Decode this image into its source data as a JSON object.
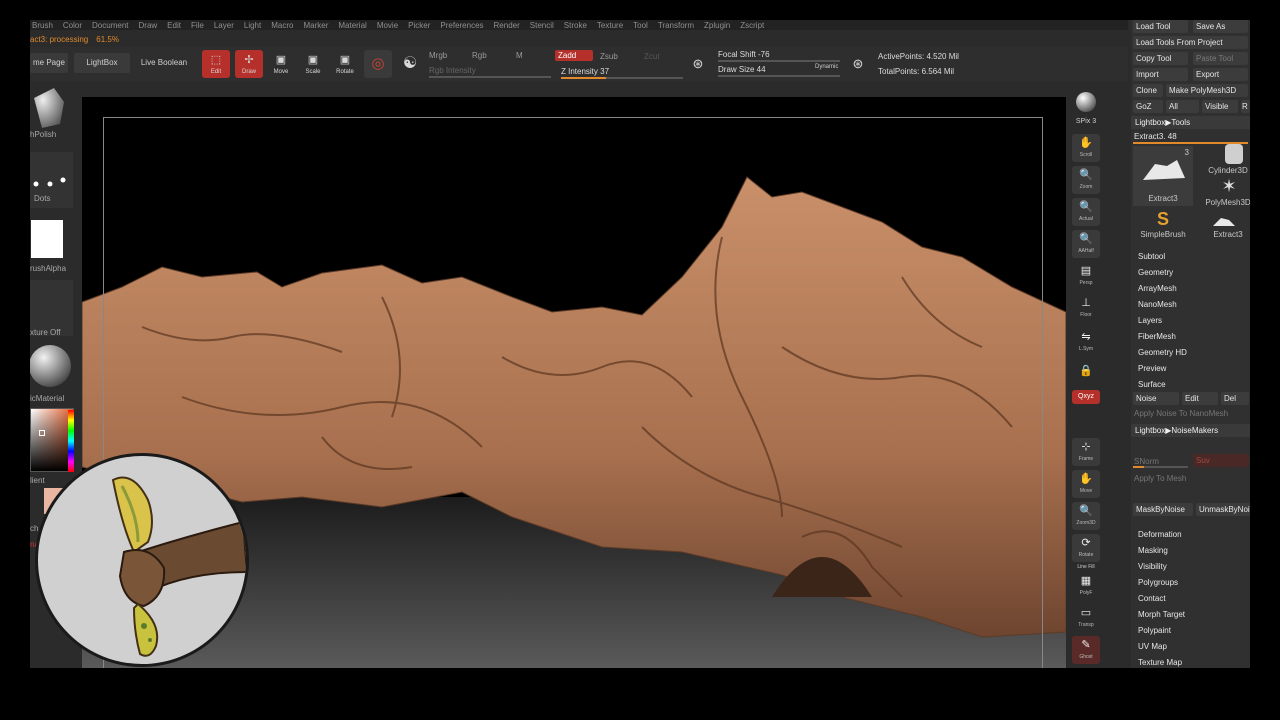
{
  "menubar": [
    "Brush",
    "Color",
    "Document",
    "Draw",
    "Edit",
    "File",
    "Layer",
    "Light",
    "Macro",
    "Marker",
    "Material",
    "Movie",
    "Picker",
    "Preferences",
    "Render",
    "Stencil",
    "Stroke",
    "Texture",
    "Tool",
    "Transform",
    "Zplugin",
    "Zscript"
  ],
  "status": {
    "task": "act3: processing",
    "percent": "61.5%"
  },
  "toolbar": {
    "home_page": "me Page",
    "lightbox": "LightBox",
    "live_boolean": "Live Boolean",
    "edit": "Edit",
    "draw": "Draw",
    "move": "Move",
    "scale": "Scale",
    "rotate": "Rotate",
    "mrgb": "Mrgb",
    "rgb": "Rgb",
    "m": "M",
    "rgb_intensity": "Rgb Intensity",
    "zadd": "Zadd",
    "zsub": "Zsub",
    "zcut": "Zcut",
    "z_intensity": "Z Intensity 37",
    "z_intensity_value": 37,
    "focal_shift": "Focal Shift -76",
    "draw_size": "Draw Size 44",
    "dynamic": "Dynamic",
    "active_points": "ActivePoints: 4.520 Mil",
    "total_points": "TotalPoints: 6.564 Mil"
  },
  "leftshelf": {
    "brush": "hPolish",
    "stroke": "Dots",
    "alpha": "rushAlpha",
    "texture": "xture Off",
    "material": "icMaterial",
    "gradient": "lient",
    "switch_color": "ch Color",
    "alternate": "nate"
  },
  "rightstrip": {
    "bpr": "BPR",
    "spix": "SPix 3",
    "scroll": "Scroll",
    "zoom": "Zoom",
    "actual": "Actual",
    "aahalf": "AAHalf",
    "dynamic": "Dynamic",
    "persp": "Persp",
    "floor": "Floor",
    "lsym": "L.Sym",
    "xyz": "Qxyz",
    "frame": "Frame",
    "move": "Move",
    "zoom3d": "Zoom3D",
    "rotate": "Rotate",
    "line_fill": "Line Fill",
    "polyf": "PolyF",
    "transp": "Transp",
    "ghost": "Ghost",
    "solo": "Dynamic"
  },
  "tool": {
    "load_tool": "Load Tool",
    "save_as": "Save As",
    "load_from_project": "Load Tools From Project",
    "copy_tool": "Copy Tool",
    "paste_tool": "Paste Tool",
    "import": "Import",
    "export": "Export",
    "clone": "Clone",
    "make_polymesh": "Make PolyMesh3D",
    "goz": "GoZ",
    "all": "All",
    "visible": "Visible",
    "r": "R",
    "lightbox_tools": "Lightbox▶Tools",
    "current_tool": "Extract3. 48",
    "thumbs": [
      {
        "name": "Extract3",
        "count": "3"
      },
      {
        "name": "Cylinder3D",
        "count": ""
      },
      {
        "name": "PolyMesh3D",
        "count": ""
      },
      {
        "name": "SimpleBrush",
        "count": ""
      },
      {
        "name": "Extract3",
        "count": ""
      }
    ],
    "subpalettes_top": [
      "Subtool",
      "Geometry",
      "ArrayMesh",
      "NanoMesh",
      "Layers",
      "FiberMesh",
      "Geometry HD",
      "Preview"
    ],
    "surface": "Surface",
    "noise": "Noise",
    "edit": "Edit",
    "del": "Del",
    "apply_noise_nano": "Apply Noise To NanoMesh",
    "lightbox_noise": "Lightbox▶NoiseMakers",
    "snorm": "SNorm",
    "suv": "Suv",
    "apply_to_mesh": "Apply To Mesh",
    "mask_by_noise": "MaskByNoise",
    "unmask_by_noise": "UnmaskByNoise",
    "subpalettes_bottom": [
      "Deformation",
      "Masking",
      "Visibility",
      "Polygroups",
      "Contact",
      "Morph Target",
      "Polypaint",
      "UV Map",
      "Texture Map"
    ]
  },
  "colors": {
    "accent": "#e08a2c",
    "active_red": "#b5302a",
    "panel": "#2b2b2b",
    "rock": "#b47a58"
  }
}
